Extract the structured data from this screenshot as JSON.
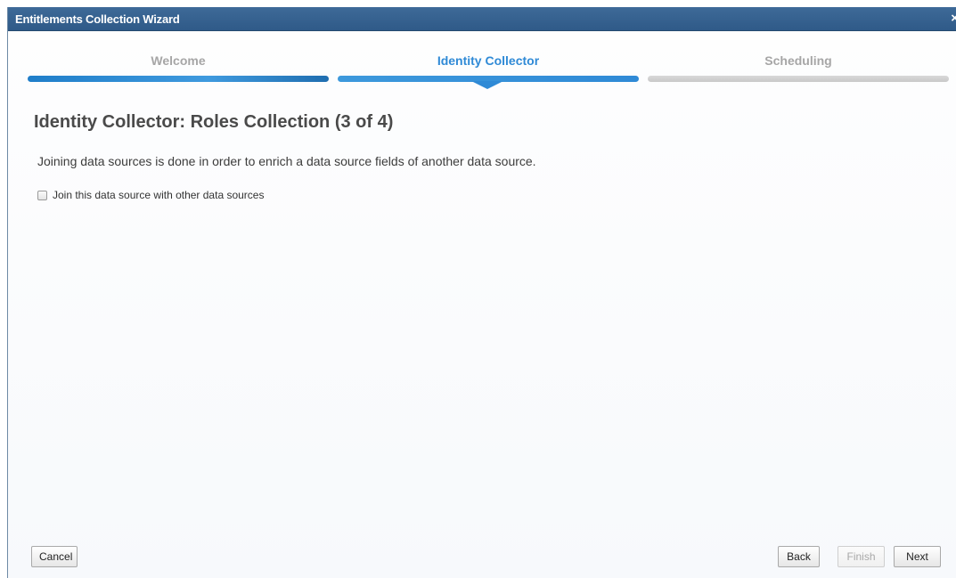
{
  "window": {
    "title": "Entitlements Collection Wizard",
    "close_glyph": "×"
  },
  "steps": [
    {
      "label": "Welcome",
      "state": "done"
    },
    {
      "label": "Identity Collector",
      "state": "active"
    },
    {
      "label": "Scheduling",
      "state": "pending"
    }
  ],
  "content": {
    "heading": "Identity Collector: Roles Collection (3 of 4)",
    "description": "Joining data sources is done in order to enrich a data source fields of another data source.",
    "join_checkbox": {
      "label": "Join this data source with other data sources",
      "checked": false
    }
  },
  "footer": {
    "cancel_label": "Cancel",
    "back_label": "Back",
    "finish_label": "Finish",
    "next_label": "Next"
  },
  "colors": {
    "titlebar": "#2f5a88",
    "active_step": "#2f8ad6",
    "pending_step": "#c9c9c9"
  },
  "icons": {
    "close": "close-icon",
    "step_pointer": "step-pointer-icon"
  }
}
